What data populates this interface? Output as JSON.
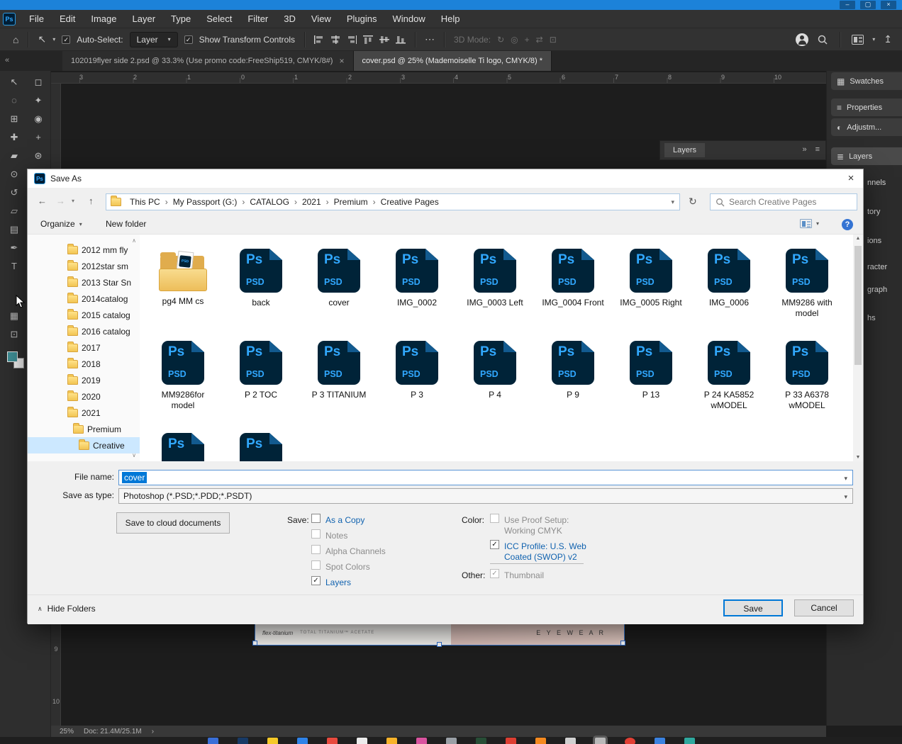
{
  "colors": {
    "accent": "#0078d7",
    "titlebar": "#1c82d9",
    "psd_navy": "#001e36",
    "psd_blue": "#31a8ff",
    "selection": "#cce8ff",
    "foreground_swatch": "#3f8f96"
  },
  "icons": {
    "check": "✓",
    "chevron_down": "▾",
    "crumb_sep": "›",
    "back": "←",
    "forward": "→",
    "up": "↑",
    "refresh": "↻",
    "close": "×",
    "minimize": "–",
    "maximize": "▢",
    "collapse_tabs": "«",
    "panel_collapse": "»",
    "panel_menu": "≡",
    "home": "⌂",
    "ellipsis": "⋯",
    "share": "↥",
    "move": "↖",
    "scroll_up": "▲",
    "scroll_down": "▼",
    "tree_up": "∧",
    "tree_down": "∨",
    "hide_chevron": "∧",
    "question": "?",
    "ps_logo": "Ps",
    "psd_ext": "PSD"
  },
  "menubar": {
    "items": [
      "File",
      "Edit",
      "Image",
      "Layer",
      "Type",
      "Select",
      "Filter",
      "3D",
      "View",
      "Plugins",
      "Window",
      "Help"
    ]
  },
  "options_bar": {
    "auto_select_label": "Auto-Select:",
    "auto_select_value": "Layer",
    "transform_label": "Show Transform Controls",
    "mode_label": "3D Mode:"
  },
  "tools": {
    "col_a": [
      {
        "name": "move-tool",
        "glyph": "↖"
      },
      {
        "name": "lasso-tool",
        "glyph": "◌"
      },
      {
        "name": "crop-tool",
        "glyph": "⊞"
      },
      {
        "name": "healing-brush-tool",
        "glyph": "✚"
      },
      {
        "name": "brush-tool",
        "glyph": "▰"
      },
      {
        "name": "clone-stamp-tool",
        "glyph": "⊙"
      },
      {
        "name": "history-brush-tool",
        "glyph": "↺"
      },
      {
        "name": "eraser-tool",
        "glyph": "▱"
      },
      {
        "name": "gradient-tool",
        "glyph": "▤"
      },
      {
        "name": "pen-tool",
        "glyph": "✒"
      },
      {
        "name": "type-tool",
        "glyph": "T"
      }
    ],
    "col_b": [
      {
        "name": "marquee-tool",
        "glyph": "◻"
      },
      {
        "name": "quick-select-tool",
        "glyph": "✦"
      },
      {
        "name": "eyedropper-tool",
        "glyph": "◉"
      },
      {
        "name": "spot-healing-tool",
        "glyph": "+"
      },
      {
        "name": "stamp-tool",
        "glyph": "⊛"
      }
    ],
    "extra": [
      {
        "name": "quick-mask-icon",
        "glyph": "▦"
      },
      {
        "name": "screen-mode-icon",
        "glyph": "⊡"
      }
    ],
    "mode_icons": [
      "↻",
      "◎",
      "+",
      "⇄",
      "⊡"
    ]
  },
  "tabs": [
    {
      "label": "102019flyer side 2.psd @ 33.3% (Use promo code:FreeShip519, CMYK/8#)"
    },
    {
      "label": "cover.psd @ 25% (Mademoiselle Ti logo, CMYK/8) *"
    }
  ],
  "ruler": {
    "top": [
      "3",
      "2",
      "1",
      "0",
      "1",
      "2",
      "3",
      "4",
      "5",
      "6",
      "7",
      "8",
      "9",
      "10"
    ],
    "left": [
      "9",
      "10"
    ]
  },
  "floating_panel": {
    "title": "Layers"
  },
  "right_panels": {
    "buttons": [
      {
        "label": "Swatches",
        "glyph": "▦"
      },
      {
        "label": "Properties",
        "glyph": "≡"
      },
      {
        "label": "Adjustm...",
        "glyph": "◐"
      },
      {
        "label": "Layers",
        "glyph": "≣"
      }
    ],
    "fragments": [
      "nnels",
      "tory",
      "ions",
      "racter",
      "graph",
      "hs"
    ]
  },
  "dialog": {
    "title": "Save As",
    "breadcrumb": [
      "This PC",
      "My Passport (G:)",
      "CATALOG",
      "2021",
      "Premium",
      "Creative Pages"
    ],
    "search_placeholder": "Search Creative Pages",
    "organize_label": "Organize",
    "new_folder_label": "New folder",
    "tree": [
      {
        "label": "2012 mm fly"
      },
      {
        "label": "2012star sm"
      },
      {
        "label": "2013 Star Sn"
      },
      {
        "label": "2014catalog"
      },
      {
        "label": "2015 catalog"
      },
      {
        "label": "2016 catalog"
      },
      {
        "label": "2017"
      },
      {
        "label": "2018"
      },
      {
        "label": "2019"
      },
      {
        "label": "2020"
      },
      {
        "label": "2021"
      },
      {
        "label": "Premium"
      },
      {
        "label": "Creative"
      }
    ],
    "files": [
      {
        "label": "pg4 MM cs",
        "type": "folder"
      },
      {
        "label": "back",
        "type": "psd"
      },
      {
        "label": "cover",
        "type": "psd"
      },
      {
        "label": "IMG_0002",
        "type": "psd"
      },
      {
        "label": "IMG_0003 Left",
        "type": "psd"
      },
      {
        "label": "IMG_0004 Front",
        "type": "psd"
      },
      {
        "label": "IMG_0005 Right",
        "type": "psd"
      },
      {
        "label": "IMG_0006",
        "type": "psd"
      },
      {
        "label": "MM9286 with model",
        "type": "psd"
      },
      {
        "label": "MM9286for model",
        "type": "psd"
      },
      {
        "label": "P 2 TOC",
        "type": "psd"
      },
      {
        "label": "P 3 TITANIUM",
        "type": "psd"
      },
      {
        "label": "P 3",
        "type": "psd"
      },
      {
        "label": "P 4",
        "type": "psd"
      },
      {
        "label": "P 9",
        "type": "psd"
      },
      {
        "label": "P 13",
        "type": "psd"
      },
      {
        "label": "P 24 KA5852 wMODEL",
        "type": "psd"
      },
      {
        "label": "P 33 A6378 wMODEL",
        "type": "psd"
      },
      {
        "label": "",
        "type": "psd"
      },
      {
        "label": "",
        "type": "psd"
      }
    ],
    "file_name_label": "File name:",
    "file_name_value": "cover",
    "save_type_label": "Save as type:",
    "save_type_value": "Photoshop (*.PSD;*.PDD;*.PSDT)",
    "cloud_button": "Save to cloud documents",
    "save_group_label": "Save:",
    "save_options": [
      {
        "label": "As a Copy",
        "checked": false,
        "enabled": true
      },
      {
        "label": "Notes",
        "checked": false,
        "enabled": false
      },
      {
        "label": "Alpha Channels",
        "checked": false,
        "enabled": false
      },
      {
        "label": "Spot Colors",
        "checked": false,
        "enabled": false
      },
      {
        "label": "Layers",
        "checked": true,
        "enabled": true
      }
    ],
    "color_group_label": "Color:",
    "color_options": [
      {
        "label": "Use Proof Setup:",
        "label2": "Working CMYK",
        "checked": false,
        "enabled": false
      },
      {
        "label": "ICC Profile: U.S. Web",
        "label2": "Coated (SWOP) v2",
        "checked": true,
        "enabled": true
      }
    ],
    "other_label": "Other:",
    "thumbnail_option": {
      "label": "Thumbnail",
      "checked": true,
      "enabled": false
    },
    "hide_folders_label": "Hide Folders",
    "save_button": "Save",
    "cancel_button": "Cancel"
  },
  "document": {
    "brand_text": "flex-titanium",
    "material_text": "TOTAL TITANIUM™ ACETATE",
    "eyewear_text": "E Y E W E A R"
  },
  "statusbar": {
    "zoom": "25%",
    "doc_info": "Doc: 21.4M/25.1M"
  }
}
